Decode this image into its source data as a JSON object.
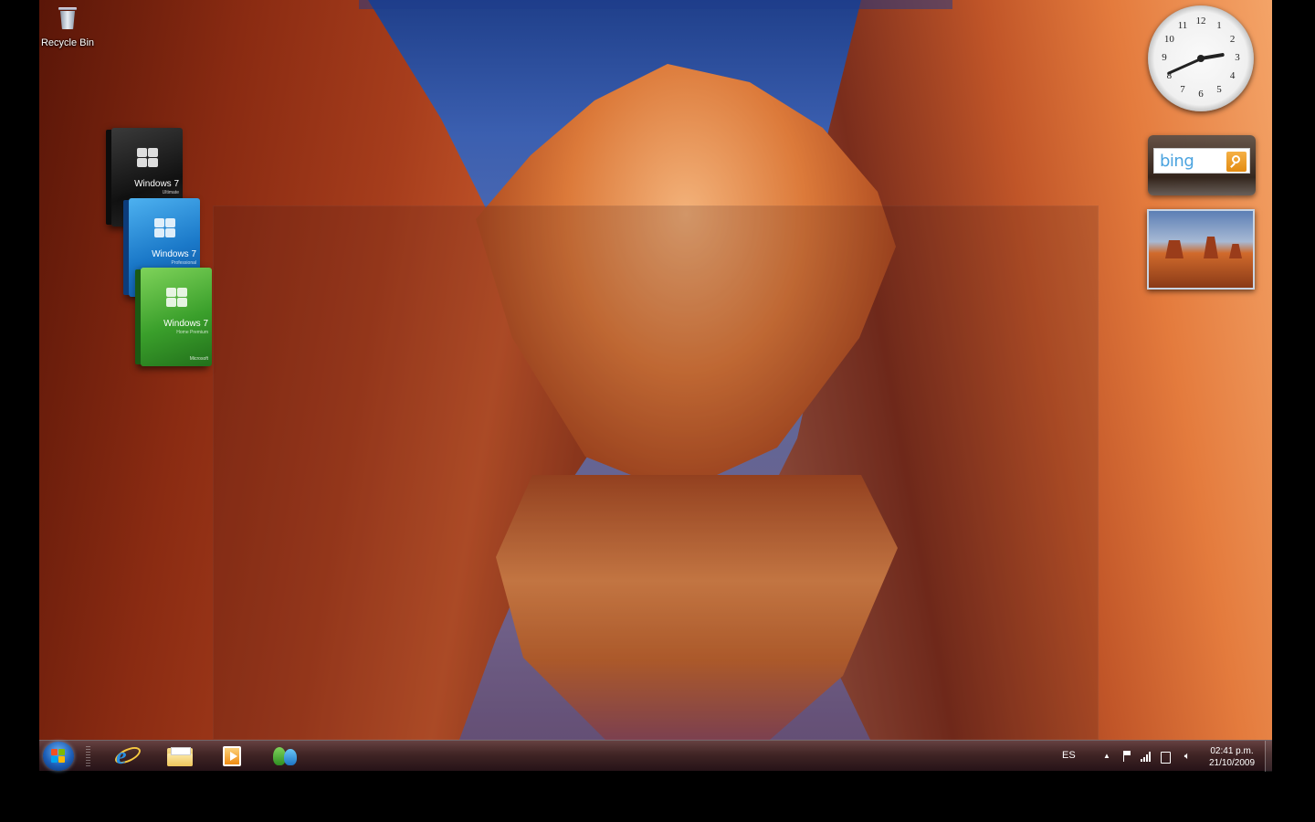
{
  "desktop": {
    "icons": [
      {
        "label": "Recycle Bin",
        "icon": "recycle-bin-icon"
      }
    ],
    "boxes": [
      {
        "title": "Windows 7",
        "edition": "Ultimate",
        "color": "#1a1a1a"
      },
      {
        "title": "Windows 7",
        "edition": "Professional",
        "color": "#1a78c8"
      },
      {
        "title": "Windows 7",
        "edition": "Home Premium",
        "color": "#3a9f2b",
        "publisher": "Microsoft"
      }
    ]
  },
  "gadgets": {
    "clock": {
      "numerals": [
        "12",
        "1",
        "2",
        "3",
        "4",
        "5",
        "6",
        "7",
        "8",
        "9",
        "10",
        "11"
      ],
      "time": "02:41"
    },
    "bing": {
      "logo_text": "bing",
      "search_icon": "search-icon",
      "accent": "#f39c1f"
    },
    "slideshow": {
      "icon": "slideshow-picture"
    }
  },
  "taskbar": {
    "start_icon": "windows-start-icon",
    "pinned": [
      {
        "name": "Internet Explorer",
        "icon": "internet-explorer-icon"
      },
      {
        "name": "Windows Explorer",
        "icon": "folder-icon"
      },
      {
        "name": "Windows Media Player",
        "icon": "media-player-icon"
      },
      {
        "name": "Windows Live Messenger",
        "icon": "messenger-icon"
      }
    ],
    "tray": {
      "language": "ES",
      "icons": [
        "show-hidden-icons-chevron",
        "action-center-flag-icon",
        "network-signal-icon",
        "power-icon",
        "volume-icon"
      ],
      "time": "02:41 p.m.",
      "date": "21/10/2009"
    }
  }
}
